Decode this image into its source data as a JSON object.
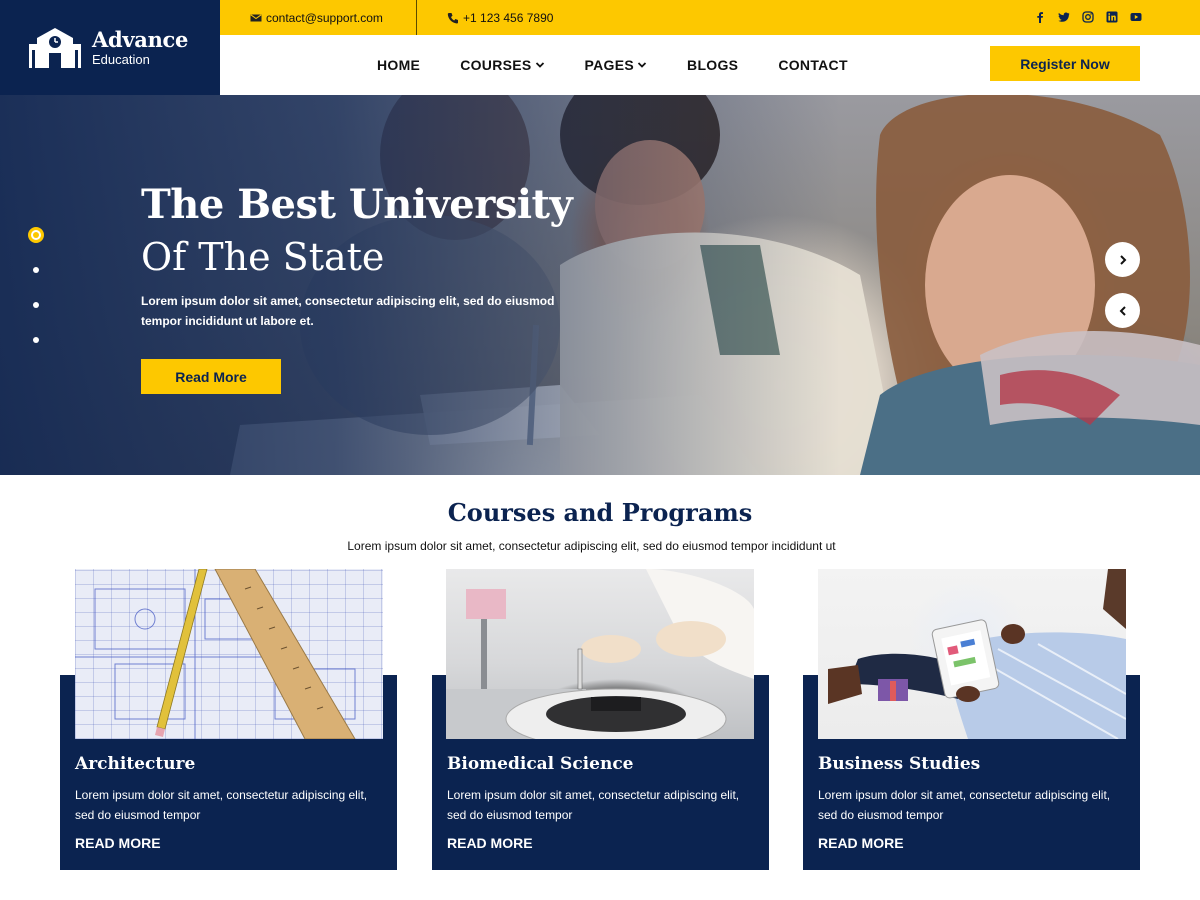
{
  "brand": {
    "title": "Advance",
    "subtitle": "Education"
  },
  "topbar": {
    "email": "contact@support.com",
    "phone": "+1 123 456 7890",
    "social_icons": [
      "facebook-icon",
      "twitter-icon",
      "instagram-icon",
      "linkedin-icon",
      "youtube-icon"
    ]
  },
  "nav": {
    "items": [
      {
        "label": "HOME",
        "has_dropdown": false
      },
      {
        "label": "COURSES",
        "has_dropdown": true
      },
      {
        "label": "PAGES",
        "has_dropdown": true
      },
      {
        "label": "BLOGS",
        "has_dropdown": false
      },
      {
        "label": "CONTACT",
        "has_dropdown": false
      }
    ],
    "register_label": "Register Now"
  },
  "hero": {
    "title": "The Best University",
    "subtitle": "Of The State",
    "text": "Lorem ipsum dolor sit amet, consectetur adipiscing elit, sed do eiusmod tempor incididunt ut labore et.",
    "button_label": "Read More",
    "slide_count": 4,
    "active_slide": 1
  },
  "courses": {
    "title": "Courses and Programs",
    "subtitle": "Lorem ipsum dolor sit amet, consectetur adipiscing elit, sed do eiusmod tempor incididunt ut",
    "cards": [
      {
        "title": "Architecture",
        "desc": "Lorem ipsum dolor sit amet, consectetur adipiscing elit, sed do eiusmod tempor",
        "link": "READ MORE"
      },
      {
        "title": "Biomedical Science",
        "desc": "Lorem ipsum dolor sit amet, consectetur adipiscing elit, sed do eiusmod tempor",
        "link": "READ MORE"
      },
      {
        "title": "Business Studies",
        "desc": "Lorem ipsum dolor sit amet, consectetur adipiscing elit, sed do eiusmod tempor",
        "link": "READ MORE"
      }
    ]
  },
  "colors": {
    "navy": "#0b2350",
    "yellow": "#fdc800",
    "white": "#ffffff"
  }
}
